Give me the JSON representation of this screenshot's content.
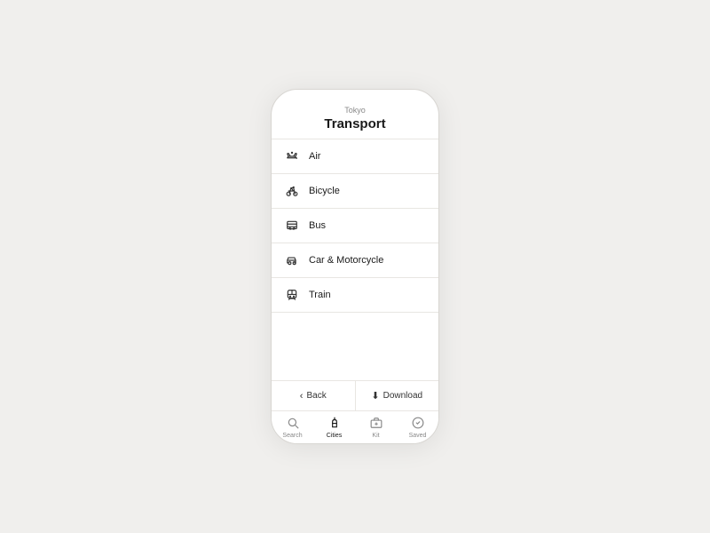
{
  "phone": {
    "city": "Tokyo",
    "title": "Transport",
    "transport_items": [
      {
        "id": "air",
        "label": "Air",
        "icon": "✈"
      },
      {
        "id": "bicycle",
        "label": "Bicycle",
        "icon": "🚲"
      },
      {
        "id": "bus",
        "label": "Bus",
        "icon": "🚌"
      },
      {
        "id": "car-motorcycle",
        "label": "Car & Motorcycle",
        "icon": "🚗"
      },
      {
        "id": "train",
        "label": "Train",
        "icon": "🚋"
      }
    ],
    "footer": {
      "back_label": "Back",
      "download_label": "Download"
    },
    "bottom_nav": [
      {
        "id": "search",
        "label": "Search",
        "icon": "search"
      },
      {
        "id": "cities",
        "label": "Cities",
        "icon": "cities",
        "active": true
      },
      {
        "id": "kit",
        "label": "Kit",
        "icon": "kit"
      },
      {
        "id": "saved",
        "label": "Saved",
        "icon": "saved"
      }
    ]
  }
}
